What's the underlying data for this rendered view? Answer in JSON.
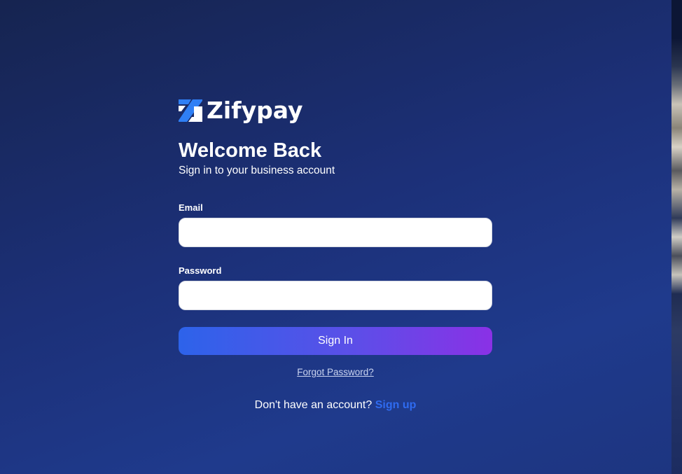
{
  "brand": {
    "name": "Zifypay",
    "logo_icon": "zifypay-z-logo-icon",
    "accent_color": "#2f6bf0"
  },
  "heading": {
    "title": "Welcome Back",
    "subtitle": "Sign in to your business account"
  },
  "form": {
    "email": {
      "label": "Email",
      "value": "",
      "placeholder": ""
    },
    "password": {
      "label": "Password",
      "value": "",
      "placeholder": ""
    },
    "submit_label": "Sign In",
    "submit_gradient": [
      "#2d63ea",
      "#8a31e6"
    ],
    "forgot_label": "Forgot Password?"
  },
  "signup": {
    "prompt": "Don't have an account?",
    "link_label": "Sign up"
  }
}
